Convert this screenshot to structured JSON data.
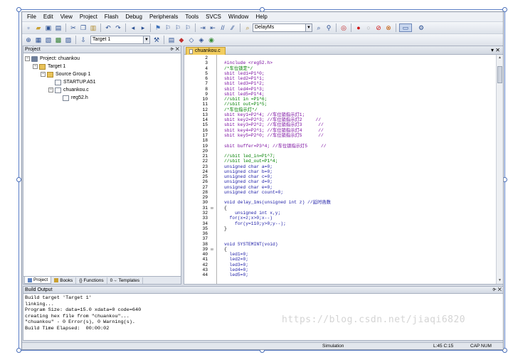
{
  "menubar": {
    "items": [
      "File",
      "Edit",
      "View",
      "Project",
      "Flash",
      "Debug",
      "Peripherals",
      "Tools",
      "SVCS",
      "Window",
      "Help"
    ]
  },
  "toolbar1": {
    "find_combo_value": "DelayMs"
  },
  "toolbar2": {
    "target_combo_value": "Target 1"
  },
  "project_pane": {
    "title": "Project",
    "controls": "⌱ ✕",
    "tree": [
      {
        "label": "Project: chuankou",
        "indent": 0,
        "toggle": "−",
        "icon": "project"
      },
      {
        "label": "Target 1",
        "indent": 1,
        "toggle": "−",
        "icon": "folder"
      },
      {
        "label": "Source Group 1",
        "indent": 2,
        "toggle": "−",
        "icon": "folder"
      },
      {
        "label": "STARTUP.A51",
        "indent": 3,
        "toggle": "",
        "icon": "file"
      },
      {
        "label": "chuankou.c",
        "indent": 3,
        "toggle": "−",
        "icon": "file"
      },
      {
        "label": "reg52.h",
        "indent": 4,
        "toggle": "",
        "icon": "file"
      }
    ],
    "tabs": [
      "Project",
      "Books",
      "{} Functions",
      "0→ Templates"
    ]
  },
  "editor": {
    "file_tab": "chuankou.c",
    "tab_controls": "▾ ✕",
    "lines": [
      {
        "n": "2",
        "fold": "",
        "text": ""
      },
      {
        "n": "3",
        "fold": "",
        "text": "#include <reg52.h>",
        "color": "#7a0ca0"
      },
      {
        "n": "4",
        "fold": "",
        "text": "/*车位锁定*/",
        "color": "#008000"
      },
      {
        "n": "5",
        "fold": "",
        "text": "sbit led1=P1^0;",
        "color": "#7a0ca0"
      },
      {
        "n": "6",
        "fold": "",
        "text": "sbit led2=P1^1;",
        "color": "#7a0ca0"
      },
      {
        "n": "7",
        "fold": "",
        "text": "sbit led3=P1^2;",
        "color": "#7a0ca0"
      },
      {
        "n": "8",
        "fold": "",
        "text": "sbit led4=P1^3;",
        "color": "#7a0ca0"
      },
      {
        "n": "9",
        "fold": "",
        "text": "sbit led5=P1^4;",
        "color": "#7a0ca0"
      },
      {
        "n": "10",
        "fold": "",
        "text": "//sbit in =P1^6;",
        "color": "#008000"
      },
      {
        "n": "11",
        "fold": "",
        "text": "//sbit out=P1^5;",
        "color": "#008000"
      },
      {
        "n": "12",
        "fold": "",
        "text": "/*车位指示灯*/",
        "color": "#008000"
      },
      {
        "n": "13",
        "fold": "",
        "text": "sbit key1=P2^4; //车位锁指示灯1;",
        "color": "#7a0ca0"
      },
      {
        "n": "14",
        "fold": "",
        "text": "sbit key2=P2^3; //车位锁指示灯2     //",
        "color": "#7a0ca0"
      },
      {
        "n": "15",
        "fold": "",
        "text": "sbit key3=P2^2; //车位锁指示灯3      //",
        "color": "#7a0ca0"
      },
      {
        "n": "16",
        "fold": "",
        "text": "sbit key4=P2^1; //车位锁指示灯4      //",
        "color": "#7a0ca0"
      },
      {
        "n": "17",
        "fold": "",
        "text": "sbit key5=P2^0; //车位锁指示灯5      //",
        "color": "#7a0ca0"
      },
      {
        "n": "18",
        "fold": "",
        "text": ""
      },
      {
        "n": "19",
        "fold": "",
        "text": "sbit buffer=P3^4; //车位锁指示灯5     //",
        "color": "#7a0ca0"
      },
      {
        "n": "20",
        "fold": "",
        "text": ""
      },
      {
        "n": "21",
        "fold": "",
        "text": "//sbit led_in=P1^7;",
        "color": "#008000"
      },
      {
        "n": "22",
        "fold": "",
        "text": "//sbit led_out=P1^4;",
        "color": "#008000"
      },
      {
        "n": "23",
        "fold": "",
        "text": "unsigned char a=0;",
        "color": "#1a1aa6"
      },
      {
        "n": "24",
        "fold": "",
        "text": "unsigned char b=0;",
        "color": "#1a1aa6"
      },
      {
        "n": "25",
        "fold": "",
        "text": "unsigned char c=0;",
        "color": "#1a1aa6"
      },
      {
        "n": "26",
        "fold": "",
        "text": "unsigned char d=0;",
        "color": "#1a1aa6"
      },
      {
        "n": "27",
        "fold": "",
        "text": "unsigned char e=0;",
        "color": "#1a1aa6"
      },
      {
        "n": "28",
        "fold": "",
        "text": "unsigned char count=0;",
        "color": "#1a1aa6"
      },
      {
        "n": "29",
        "fold": "",
        "text": ""
      },
      {
        "n": "30",
        "fold": "",
        "text": "void delay_1ms(unsigned int z) //延时函数",
        "color": "#1a1aa6"
      },
      {
        "n": "31",
        "fold": "⊟",
        "text": "{"
      },
      {
        "n": "32",
        "fold": "",
        "text": "    unsigned int x,y;",
        "color": "#1a1aa6"
      },
      {
        "n": "33",
        "fold": "",
        "text": "  for(x=z;x>0;x--)",
        "color": "#1a1aa6"
      },
      {
        "n": "34",
        "fold": "",
        "text": "    for(y=110;y>0;y--);",
        "color": "#1a1aa6"
      },
      {
        "n": "35",
        "fold": "",
        "text": "}"
      },
      {
        "n": "36",
        "fold": "",
        "text": ""
      },
      {
        "n": "37",
        "fold": "",
        "text": ""
      },
      {
        "n": "38",
        "fold": "",
        "text": "void SYSTEMINT(void)",
        "color": "#1a1aa6"
      },
      {
        "n": "39",
        "fold": "⊟",
        "text": "{"
      },
      {
        "n": "40",
        "fold": "",
        "text": "  led1=0;",
        "color": "#1a1aa6"
      },
      {
        "n": "41",
        "fold": "",
        "text": "  led2=0;",
        "color": "#1a1aa6"
      },
      {
        "n": "42",
        "fold": "",
        "text": "  led3=0;",
        "color": "#1a1aa6"
      },
      {
        "n": "43",
        "fold": "",
        "text": "  led4=0;",
        "color": "#1a1aa6"
      },
      {
        "n": "44",
        "fold": "",
        "text": "  led5=0;",
        "color": "#1a1aa6"
      }
    ]
  },
  "build_output": {
    "title": "Build Output",
    "controls": "⌱ ✕",
    "lines": [
      "Build target 'Target 1'",
      "linking...",
      "Program Size: data=15.0 xdata=0 code=640",
      "creating hex file from \"chuankou\"...",
      "\"chuankou\" - 0 Error(s), 0 Warning(s).",
      "Build Time Elapsed:  00:00:02"
    ]
  },
  "statusbar": {
    "mode": "Simulation",
    "position": "L:45 C:15",
    "keys": "CAP  NUM"
  },
  "watermark": "https://blog.csdn.net/jiaqi6820"
}
